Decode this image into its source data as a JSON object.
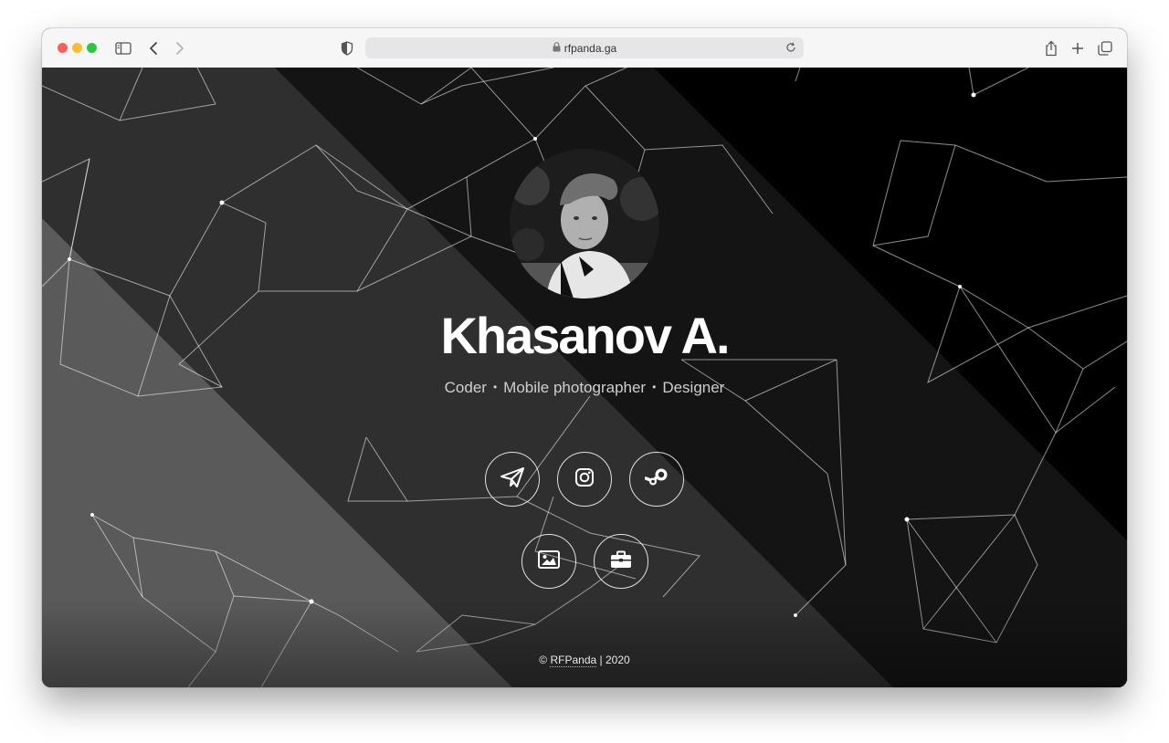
{
  "browser": {
    "url": "rfpanda.ga",
    "traffic_lights": {
      "close": "#fe5f57",
      "minimize": "#febc2e",
      "zoom": "#28c840"
    },
    "icons": [
      "sidebar-icon",
      "back-icon",
      "forward-icon",
      "shield-icon",
      "lock-icon",
      "reload-icon",
      "share-icon",
      "new-tab-icon",
      "tab-overview-icon"
    ]
  },
  "profile": {
    "name": "Khasanov A.",
    "roles": [
      "Coder",
      "Mobile photographer",
      "Designer"
    ],
    "role_separator": "•"
  },
  "social": [
    {
      "name": "telegram",
      "icon": "paper-plane-icon"
    },
    {
      "name": "instagram",
      "icon": "instagram-icon"
    },
    {
      "name": "steam",
      "icon": "steam-icon"
    },
    {
      "name": "photos",
      "icon": "image-icon"
    },
    {
      "name": "portfolio",
      "icon": "briefcase-icon"
    }
  ],
  "footer": {
    "copyright": "©",
    "author": "RFPanda",
    "separator": "|",
    "year": "2020"
  },
  "colors": {
    "background": "#000000",
    "band_light": "#5a5a5a",
    "band_mid": "#2f2f2f",
    "band_dark": "#141414",
    "text": "#ffffff"
  }
}
